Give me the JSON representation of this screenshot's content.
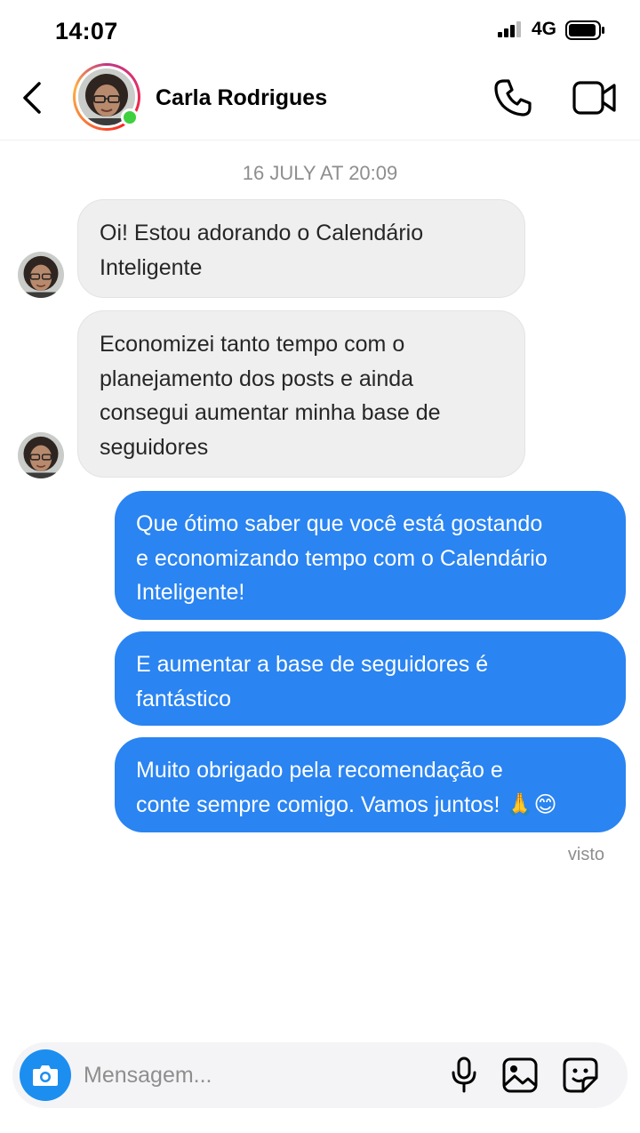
{
  "status_bar": {
    "time": "14:07",
    "network": "4G"
  },
  "header": {
    "contact_name": "Carla Rodrigues",
    "online": true
  },
  "conversation": {
    "timestamp": "16 JULY AT 20:09",
    "messages": [
      {
        "direction": "incoming",
        "text": "Oi! Estou adorando o Calendário\nInteligente"
      },
      {
        "direction": "incoming",
        "text": "Economizei tanto tempo com o\nplanejamento dos posts e ainda\nconsegui aumentar minha base de\nseguidores"
      },
      {
        "direction": "outgoing",
        "text": "Que ótimo saber que você está gostando\ne economizando tempo com o Calendário\nInteligente!"
      },
      {
        "direction": "outgoing",
        "text": "E aumentar a base de seguidores é\nfantástico"
      },
      {
        "direction": "outgoing",
        "text": "Muito obrigado pela recomendação e\nconte sempre comigo. Vamos juntos! 🙏😊"
      }
    ],
    "seen_label": "visto"
  },
  "composer": {
    "placeholder": "Mensagem..."
  },
  "icons": {
    "back": "chevron-left-icon",
    "phone": "phone-icon",
    "video": "video-camera-icon",
    "camera": "camera-icon",
    "mic": "microphone-icon",
    "gallery": "image-icon",
    "sticker": "sticker-icon"
  },
  "colors": {
    "outgoing_bubble": "#2a84f1",
    "incoming_bubble": "#efefef",
    "online": "#3fd03f",
    "camera_button": "#1c8ef0"
  }
}
